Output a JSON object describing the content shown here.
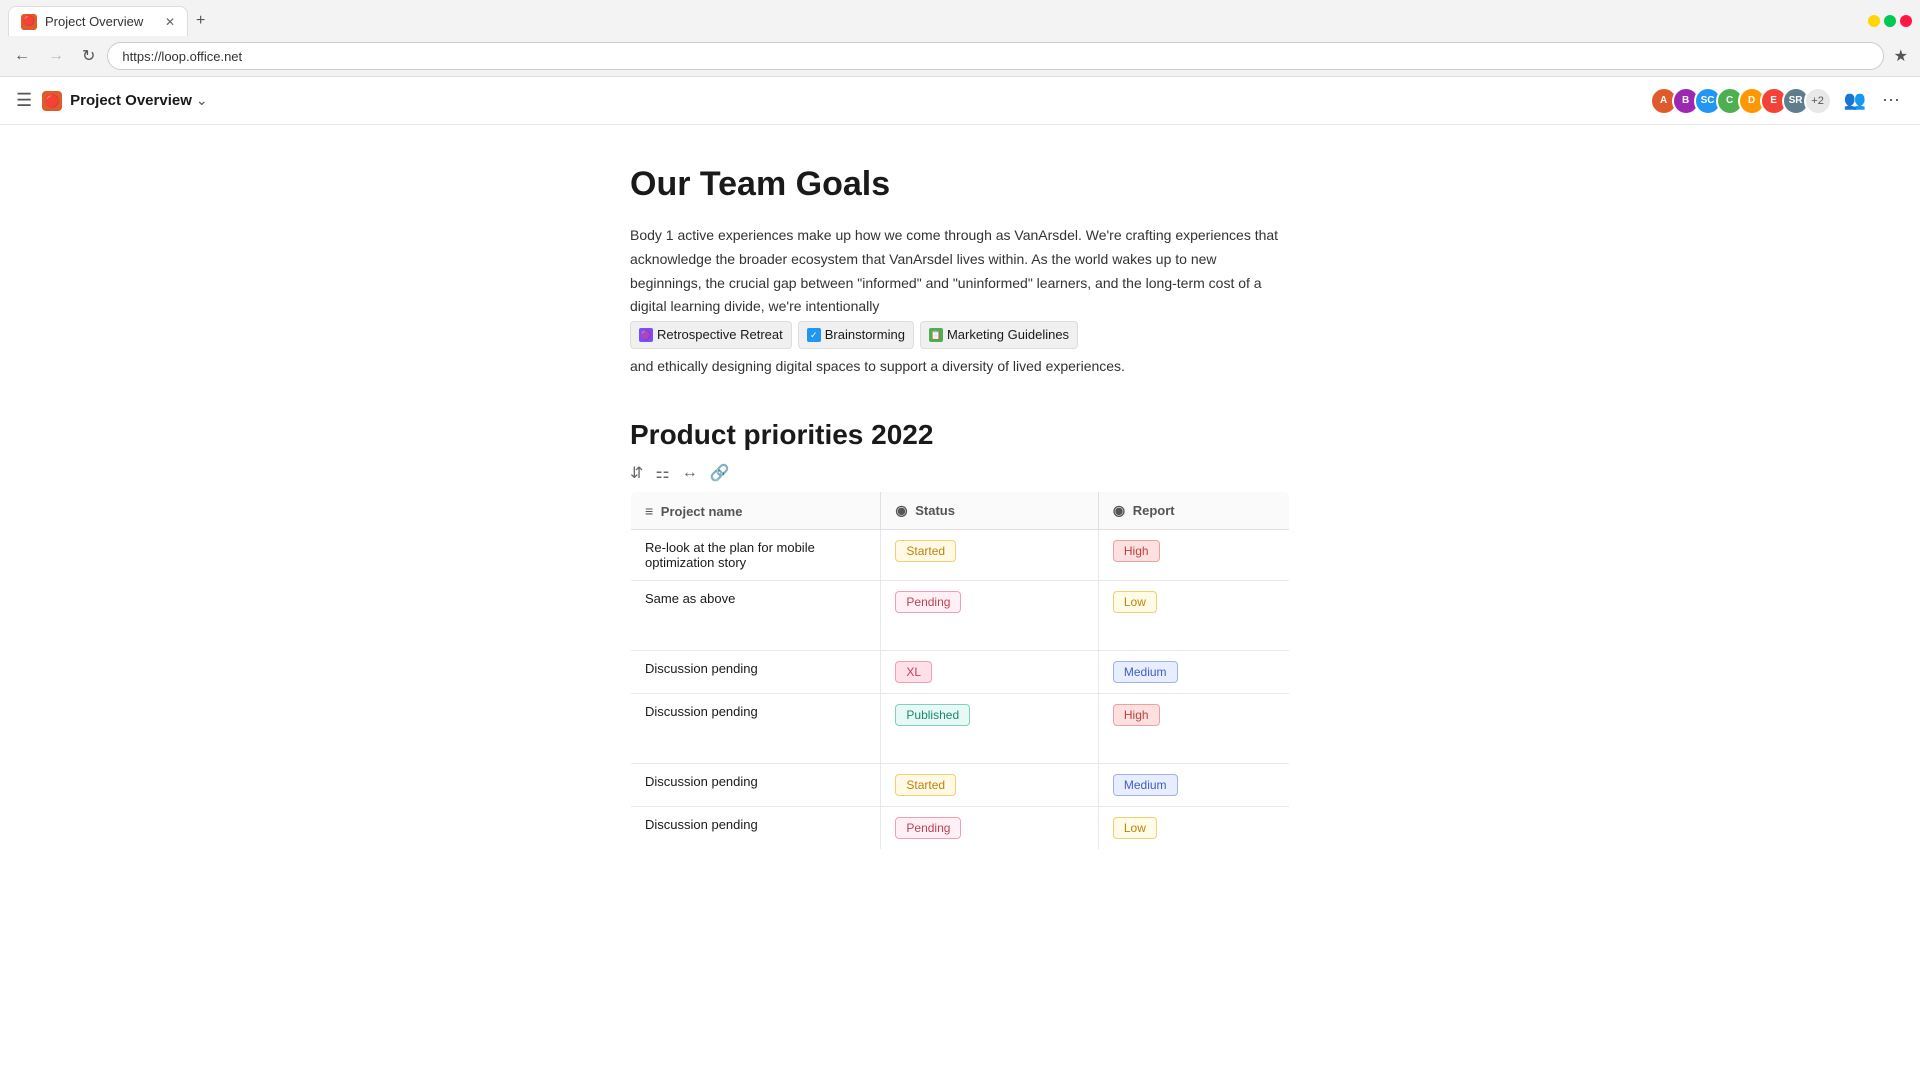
{
  "browser": {
    "tab_label": "Project Overview",
    "tab_favicon": "P",
    "url": "https://loop.office.net",
    "new_tab_btn": "+",
    "back_disabled": false,
    "forward_disabled": true
  },
  "appbar": {
    "title": "Project Overview",
    "favicon": "P",
    "chevron": "∨",
    "sidebar_icon": "☰",
    "people_count": "+2",
    "more_icon": "···"
  },
  "page": {
    "heading": "Our Team Goals",
    "body1": "Body 1 active experiences make up how we come through as VanArsdel. We're crafting experiences that acknowledge the broader ecosystem that VanArsdel lives within. As the world wakes up to new beginnings, the crucial gap between \"informed\" and \"uninformed\" learners, and the long-term cost of a digital learning divide, we're intentionally",
    "body2": "and ethically designing digital spaces to support a diversity of lived experiences.",
    "chips": [
      {
        "label": "Retrospective Retreat",
        "icon": "🟣",
        "type": "purple"
      },
      {
        "label": "Brainstorming",
        "icon": "✅",
        "type": "blue"
      },
      {
        "label": "Marketing Guidelines",
        "icon": "📋",
        "type": "green"
      }
    ],
    "section_heading": "Product priorities 2022",
    "table": {
      "headers": [
        {
          "icon": "≡",
          "label": "Project name"
        },
        {
          "icon": "◎",
          "label": "Status"
        },
        {
          "icon": "◎",
          "label": "Report"
        }
      ],
      "rows": [
        {
          "project": "Re-look at the plan for mobile optimization story",
          "status": "Started",
          "status_type": "started",
          "report": "High",
          "report_type": "high"
        },
        {
          "project": "Same as above",
          "status": "Pending",
          "status_type": "pending",
          "report": "Low",
          "report_type": "low"
        },
        {
          "project": "Discussion pending",
          "status": "XL",
          "status_type": "xl",
          "report": "Medium",
          "report_type": "medium"
        },
        {
          "project": "Discussion pending",
          "status": "Published",
          "status_type": "published",
          "report": "High",
          "report_type": "high"
        },
        {
          "project": "Discussion pending",
          "status": "Started",
          "status_type": "started",
          "report": "Medium",
          "report_type": "medium"
        },
        {
          "project": "Discussion pending",
          "status": "Pending",
          "status_type": "pending",
          "report": "Low",
          "report_type": "low"
        }
      ]
    }
  },
  "avatars": [
    {
      "color": "#e05a2b",
      "initials": "A"
    },
    {
      "color": "#9c27b0",
      "initials": "B"
    },
    {
      "color": "#2196f3",
      "initials": "SC"
    },
    {
      "color": "#4caf50",
      "initials": "C"
    },
    {
      "color": "#ff9800",
      "initials": "D"
    },
    {
      "color": "#f44336",
      "initials": "E"
    },
    {
      "color": "#607d8b",
      "initials": "SR"
    }
  ]
}
